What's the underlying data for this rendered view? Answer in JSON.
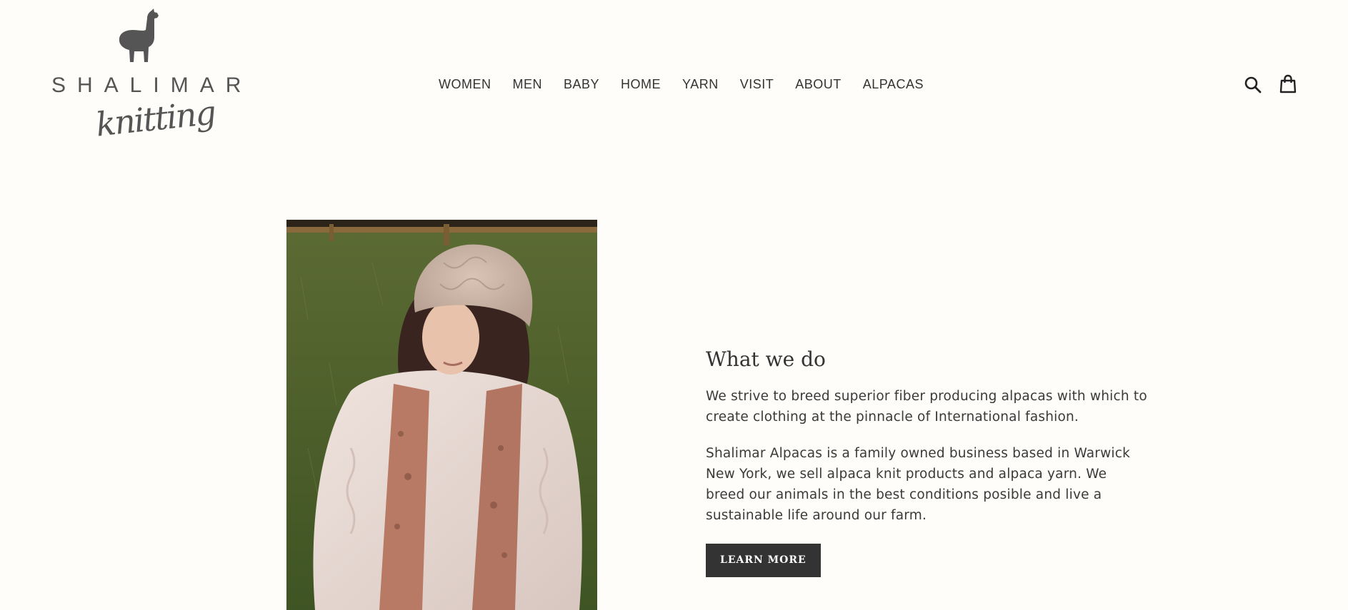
{
  "header": {
    "logo": {
      "wordmark": "SHALIMAR",
      "script": "knitting",
      "icon": "alpaca-icon"
    },
    "nav": [
      {
        "label": "WOMEN"
      },
      {
        "label": "MEN"
      },
      {
        "label": "BABY"
      },
      {
        "label": "HOME"
      },
      {
        "label": "YARN"
      },
      {
        "label": "VISIT"
      },
      {
        "label": "ABOUT"
      },
      {
        "label": "ALPACAS"
      }
    ],
    "icons": {
      "search": "search-icon",
      "cart": "shopping-bag-icon"
    }
  },
  "feature": {
    "image": "woman-in-knit-hat-and-scarf-photo",
    "heading": "What we do",
    "paragraph_1": "We strive to breed superior fiber producing alpacas with which to create clothing at the pinnacle of International fashion.",
    "paragraph_2": "Shalimar Alpacas is a family owned business based in Warwick New York, we sell alpaca knit products and alpaca yarn. We breed our animals in the best conditions posible and live a sustainable life around our farm.",
    "button_label": "LEARN MORE"
  },
  "colors": {
    "background": "#fefdfa",
    "text": "#333333",
    "button": "#333333",
    "logo": "#555555"
  }
}
